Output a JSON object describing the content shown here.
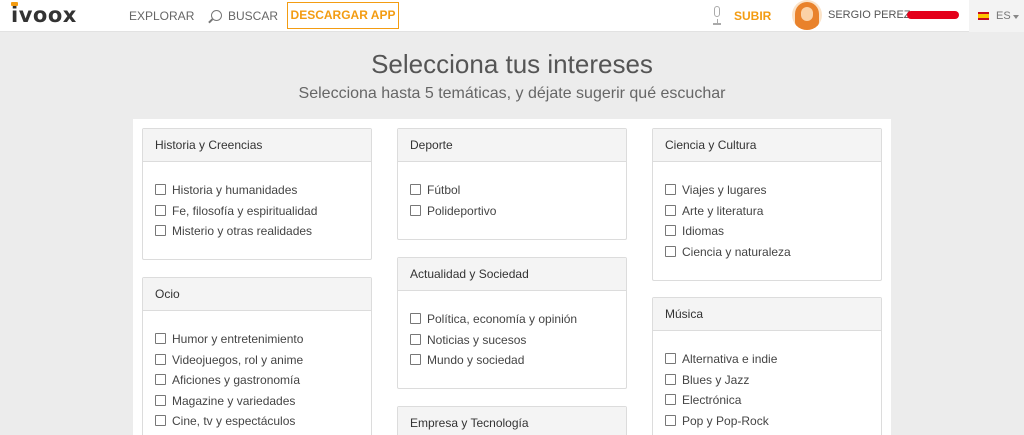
{
  "header": {
    "logo": "ivoox",
    "nav_explore": "EXPLORAR",
    "nav_search": "BUSCAR",
    "download_app": "DESCARGAR APP",
    "upload": "SUBIR",
    "user_name": "SERGIO PEREZ",
    "language": "ES",
    "colors": {
      "accent": "#f39c12",
      "redaction": "#e4001b"
    }
  },
  "page": {
    "title": "Selecciona tus intereses",
    "subtitle": "Selecciona hasta 5 temáticas, y déjate sugerir qué escuchar"
  },
  "categories": [
    {
      "name": "Historia y Creencias",
      "items": [
        "Historia y humanidades",
        "Fe, filosofía y espiritualidad",
        "Misterio y otras realidades"
      ]
    },
    {
      "name": "Ocio",
      "items": [
        "Humor y entretenimiento",
        "Videojuegos, rol y anime",
        "Aficiones y gastronomía",
        "Magazine y variedades",
        "Cine, tv y espectáculos"
      ]
    },
    {
      "name": "Deporte",
      "items": [
        "Fútbol",
        "Polideportivo"
      ]
    },
    {
      "name": "Actualidad y Sociedad",
      "items": [
        "Política, economía y opinión",
        "Noticias y sucesos",
        "Mundo y sociedad"
      ]
    },
    {
      "name": "Empresa y Tecnología",
      "items": []
    },
    {
      "name": "Ciencia y Cultura",
      "items": [
        "Viajes y lugares",
        "Arte y literatura",
        "Idiomas",
        "Ciencia y naturaleza"
      ]
    },
    {
      "name": "Música",
      "items": [
        "Alternativa e indie",
        "Blues y Jazz",
        "Electrónica",
        "Pop y Pop-Rock"
      ]
    }
  ]
}
